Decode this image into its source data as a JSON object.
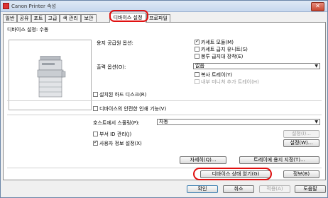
{
  "window": {
    "title": "Canon Printer 속성",
    "close_glyph": "✕"
  },
  "tabs": [
    {
      "label": "일반"
    },
    {
      "label": "공유"
    },
    {
      "label": "포트"
    },
    {
      "label": "고급"
    },
    {
      "label": "색 관리"
    },
    {
      "label": "보안"
    },
    {
      "label": "디바이스 설정",
      "active": true
    },
    {
      "label": "프로파일"
    }
  ],
  "device": {
    "settings_label": "디바이스 설정: 수동"
  },
  "paper_source": {
    "label": "용지 공급원 옵션:",
    "options": [
      {
        "label": "카세트 모듈(M)",
        "checked": true
      },
      {
        "label": "카세트 급지 유니트(S)",
        "checked": false
      },
      {
        "label": "봉투 급지대 장착(E)",
        "checked": false
      }
    ]
  },
  "output": {
    "label": "출력 옵션(O):",
    "value": "없음",
    "options": [
      {
        "label": "복사 트레이(Y)",
        "checked": false,
        "disabled": false
      },
      {
        "label": "내부 미니쳐 추가 트레이(H)",
        "checked": false,
        "disabled": true
      }
    ]
  },
  "checks": {
    "hdd": "설치된 하드 디스크(R)",
    "secure_print": "디바이스의 안전한 인쇄 기능(V)"
  },
  "spooling": {
    "label": "호스트에서 스풀링(P):",
    "value": "자동"
  },
  "dept_id": {
    "label": "부서 ID 관리(J)",
    "settings_button": "설정(I)..."
  },
  "user_auth": {
    "label": "사용자 정보 설정(X)",
    "settings_button": "설정(W)..."
  },
  "buttons": {
    "details": "자세히(Q)...",
    "tray_paper": "트레이에 용지 지정(T)...",
    "get_device_status": "디바이스 상태 얻기(G)",
    "info": "정보(B)",
    "ok": "확인",
    "cancel": "취소",
    "apply": "적용(A)",
    "help": "도움말"
  },
  "colors": {
    "highlight_ring": "#e01010",
    "titlebar": "#c7d8ee"
  }
}
